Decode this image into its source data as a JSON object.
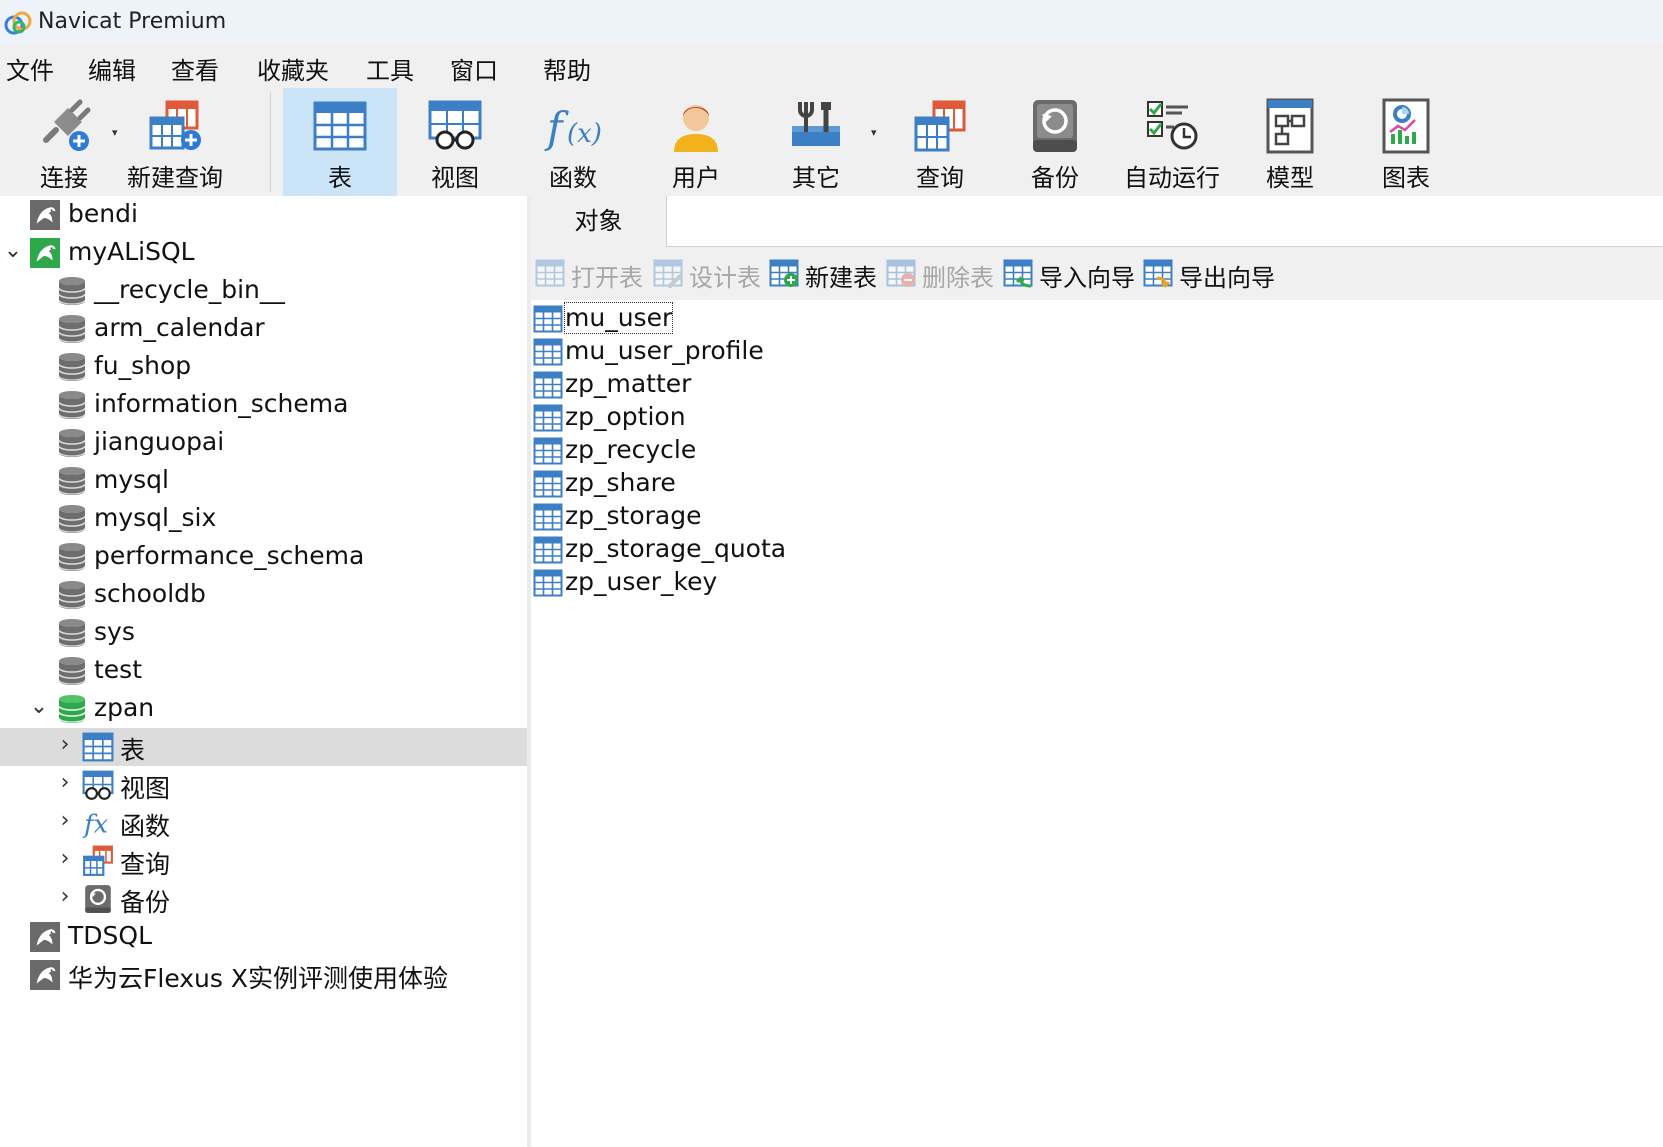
{
  "window": {
    "title": "Navicat Premium"
  },
  "menu": [
    "文件",
    "编辑",
    "查看",
    "收藏夹",
    "工具",
    "窗口",
    "帮助"
  ],
  "toolbar": {
    "connect": "连接",
    "new_query": "新建查询",
    "table": "表",
    "view": "视图",
    "function": "函数",
    "user": "用户",
    "other": "其它",
    "query": "查询",
    "backup": "备份",
    "automation": "自动运行",
    "model": "模型",
    "chart": "图表"
  },
  "sidebar": {
    "connections": [
      {
        "name": "bendi"
      },
      {
        "name": "myALiSQL"
      },
      {
        "name": "TDSQL"
      },
      {
        "name": "华为云Flexus X实例评测使用体验"
      }
    ],
    "databases": [
      "__recycle_bin__",
      "arm_calendar",
      "fu_shop",
      "information_schema",
      "jianguopai",
      "mysql",
      "mysql_six",
      "performance_schema",
      "schooldb",
      "sys",
      "test",
      "zpan"
    ],
    "zpan_children": [
      "表",
      "视图",
      "函数",
      "查询",
      "备份"
    ]
  },
  "main": {
    "tab_label": "对象",
    "object_toolbar": {
      "open_table": "打开表",
      "design_table": "设计表",
      "new_table": "新建表",
      "delete_table": "删除表",
      "import_wizard": "导入向导",
      "export_wizard": "导出向导"
    },
    "tables": [
      "mu_user",
      "mu_user_profile",
      "zp_matter",
      "zp_option",
      "zp_recycle",
      "zp_share",
      "zp_storage",
      "zp_storage_quota",
      "zp_user_key"
    ]
  },
  "colors": {
    "accent_selected_tool": "#cce4f7",
    "tree_selection": "#dcdcdc",
    "active_db_green": "#2ea84a",
    "table_icon_blue": "#3c7fc4"
  }
}
